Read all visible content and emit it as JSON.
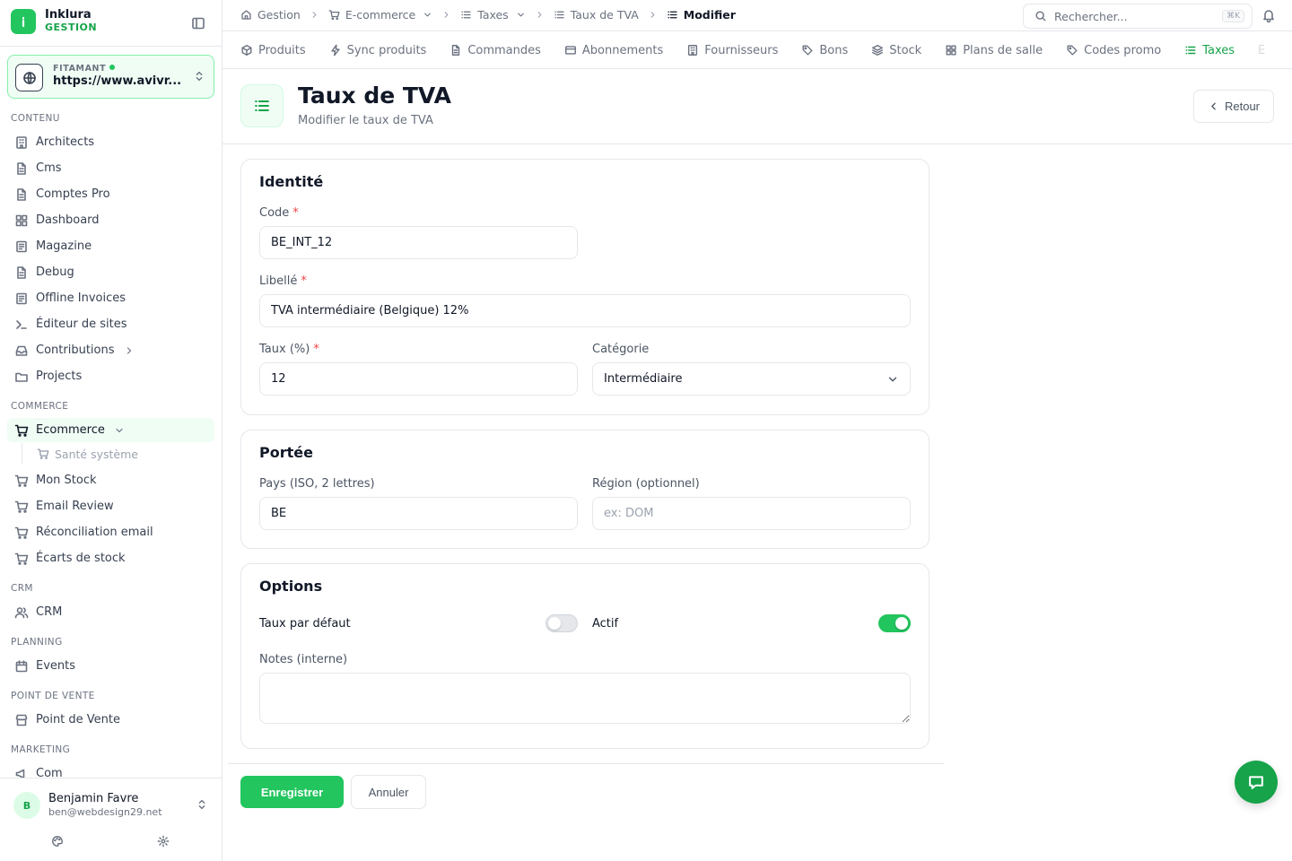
{
  "brand": {
    "name": "Inklura",
    "subtitle": "GESTION"
  },
  "site": {
    "label": "FITAMANT",
    "url": "https://www.avivr..."
  },
  "sidebar": {
    "sections": {
      "contenu": "CONTENU",
      "commerce": "COMMERCE",
      "crm": "CRM",
      "planning": "PLANNING",
      "pos": "POINT DE VENTE",
      "marketing": "MARKETING"
    },
    "contenu_items": [
      "Architects",
      "Cms",
      "Comptes Pro",
      "Dashboard",
      "Magazine",
      "Debug",
      "Offline Invoices",
      "Éditeur de sites",
      "Contributions",
      "Projects"
    ],
    "commerce_items": [
      "Ecommerce",
      "Santé système",
      "Mon Stock",
      "Email Review",
      "Réconciliation email",
      "Écarts de stock"
    ],
    "crm_items": [
      "CRM"
    ],
    "planning_items": [
      "Events"
    ],
    "pos_items": [
      "Point de Vente"
    ],
    "marketing_items": [
      "Com"
    ]
  },
  "user": {
    "initial": "B",
    "name": "Benjamin Favre",
    "email": "ben@webdesign29.net"
  },
  "breadcrumbs": [
    "Gestion",
    "E-commerce",
    "Taxes",
    "Taux de TVA",
    "Modifier"
  ],
  "search": {
    "placeholder": "Rechercher...",
    "shortcut": "⌘K"
  },
  "tabs": [
    "Produits",
    "Sync produits",
    "Commandes",
    "Abonnements",
    "Fournisseurs",
    "Bons",
    "Stock",
    "Plans de salle",
    "Codes promo",
    "Taxes",
    "E"
  ],
  "page": {
    "title": "Taux de TVA",
    "subtitle": "Modifier le taux de TVA",
    "back_label": "Retour"
  },
  "identite": {
    "title": "Identité",
    "code_label": "Code",
    "code_value": "BE_INT_12",
    "libelle_label": "Libellé",
    "libelle_value": "TVA intermédiaire (Belgique) 12%",
    "taux_label": "Taux (%)",
    "taux_value": "12",
    "categorie_label": "Catégorie",
    "categorie_value": "Intermédiaire"
  },
  "portee": {
    "title": "Portée",
    "pays_label": "Pays (ISO, 2 lettres)",
    "pays_value": "BE",
    "region_label": "Région (optionnel)",
    "region_placeholder": "ex: DOM"
  },
  "options": {
    "title": "Options",
    "defaut_label": "Taux par défaut",
    "defaut_on": false,
    "actif_label": "Actif",
    "actif_on": true,
    "notes_label": "Notes (interne)",
    "notes_value": ""
  },
  "actions": {
    "save": "Enregistrer",
    "cancel": "Annuler"
  },
  "required_mark": "*",
  "colors": {
    "accent": "#22c55e",
    "accent_dark": "#16a34a",
    "required": "#ef4444"
  }
}
